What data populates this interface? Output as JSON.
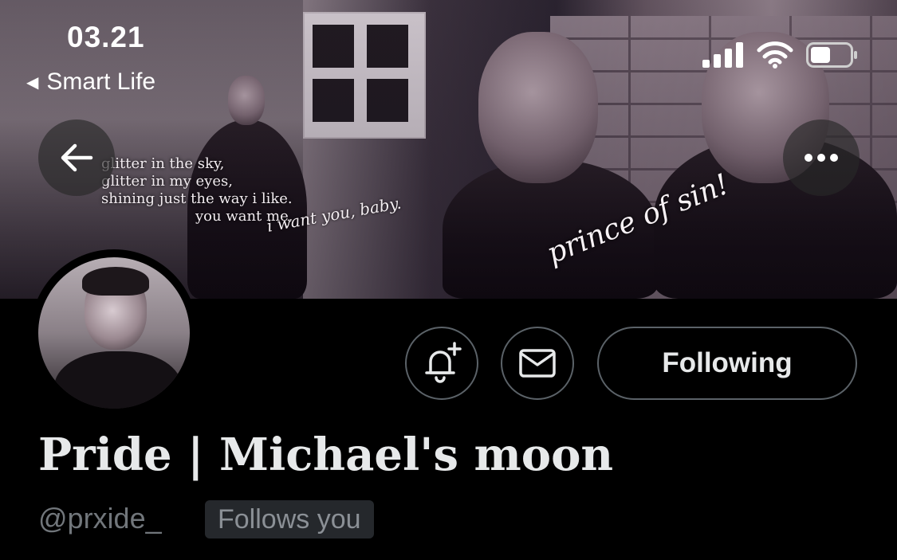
{
  "status_bar": {
    "time": "03.21",
    "back_app_label": "Smart Life",
    "icons": [
      "cellular-signal-icon",
      "wifi-icon",
      "battery-icon"
    ]
  },
  "header": {
    "back_icon": "arrow-left-icon",
    "more_icon": "more-horizontal-icon"
  },
  "banner": {
    "quote_lines": [
      "glitter in the sky,",
      "glitter in my eyes,",
      "shining just the way i like.",
      "you want me,"
    ],
    "script_text_1": "i want you, baby.",
    "script_text_2": "prince of sin!"
  },
  "actions": {
    "notify_icon": "bell-plus-icon",
    "message_icon": "envelope-icon",
    "following_label": "Following"
  },
  "profile": {
    "display_name": "Pride | Michael's moon",
    "handle": "@prxide_",
    "follows_you_label": "Follows you"
  },
  "colors": {
    "background": "#000000",
    "primary_text": "#e7e9ea",
    "secondary_text": "#71767b",
    "button_border": "#5b6268",
    "badge_bg": "#25282c"
  }
}
